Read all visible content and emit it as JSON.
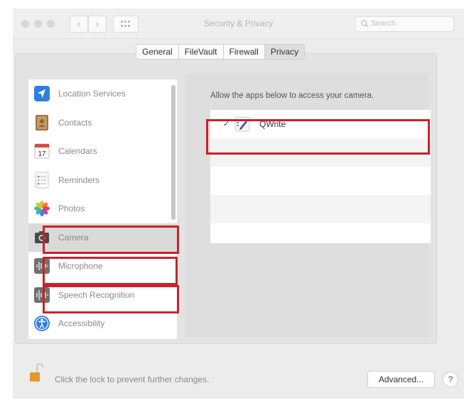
{
  "window": {
    "title": "Security & Privacy",
    "search_placeholder": "Search",
    "back": "‹",
    "forward": "›"
  },
  "tabs": [
    {
      "label": "General"
    },
    {
      "label": "FileVault"
    },
    {
      "label": "Firewall"
    },
    {
      "label": "Privacy",
      "active": true
    }
  ],
  "sidebar": {
    "items": [
      {
        "label": "Location Services",
        "icon": "location-arrow-icon"
      },
      {
        "label": "Contacts",
        "icon": "contacts-book-icon"
      },
      {
        "label": "Calendars",
        "icon": "calendar-icon",
        "day": "17"
      },
      {
        "label": "Reminders",
        "icon": "reminders-list-icon"
      },
      {
        "label": "Photos",
        "icon": "photos-flower-icon"
      },
      {
        "label": "Camera",
        "icon": "camera-icon",
        "selected": true
      },
      {
        "label": "Microphone",
        "icon": "microphone-waveform-icon"
      },
      {
        "label": "Speech Recognition",
        "icon": "speech-waveform-icon"
      },
      {
        "label": "Accessibility",
        "icon": "accessibility-icon"
      }
    ]
  },
  "main": {
    "description": "Allow the apps below to access your camera.",
    "apps": [
      {
        "name": "QWrite",
        "checked": true,
        "check_glyph": "✓",
        "icon": "qwrite-app-icon"
      }
    ]
  },
  "footer": {
    "lock_text": "Click the lock to prevent further changes.",
    "advanced_label": "Advanced...",
    "help_label": "?"
  },
  "colors": {
    "highlight": "#c8232b",
    "background": "#ececec"
  }
}
